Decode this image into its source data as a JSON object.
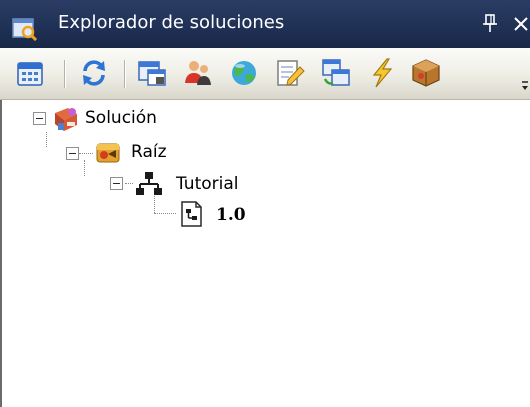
{
  "panel": {
    "title": "Explorador de soluciones",
    "title_icon": "solution-explorer-icon",
    "title_bar_color": "#1f3055",
    "controls": [
      {
        "name": "pin-icon",
        "glyph": "ꟷ"
      },
      {
        "name": "close-icon",
        "glyph": "×"
      }
    ]
  },
  "toolbar": {
    "buttons": [
      {
        "name": "properties-icon"
      },
      {
        "name": "refresh-icon"
      },
      {
        "name": "new-window-icon"
      },
      {
        "name": "users-icon"
      },
      {
        "name": "database-icon"
      },
      {
        "name": "edit-icon"
      },
      {
        "name": "windows-icon"
      },
      {
        "name": "lightning-icon"
      },
      {
        "name": "package-icon"
      }
    ]
  },
  "tree": {
    "nodes": [
      {
        "label": "Solución",
        "icon": "solution-icon",
        "level": 0,
        "expanded": true,
        "bold": false
      },
      {
        "label": "Raíz",
        "icon": "root-folder-icon",
        "level": 1,
        "expanded": true,
        "bold": false
      },
      {
        "label": "Tutorial",
        "icon": "hierarchy-icon",
        "level": 2,
        "expanded": true,
        "bold": false
      },
      {
        "label": "1.0",
        "icon": "version-document-icon",
        "level": 3,
        "expanded": false,
        "bold": true
      }
    ]
  }
}
